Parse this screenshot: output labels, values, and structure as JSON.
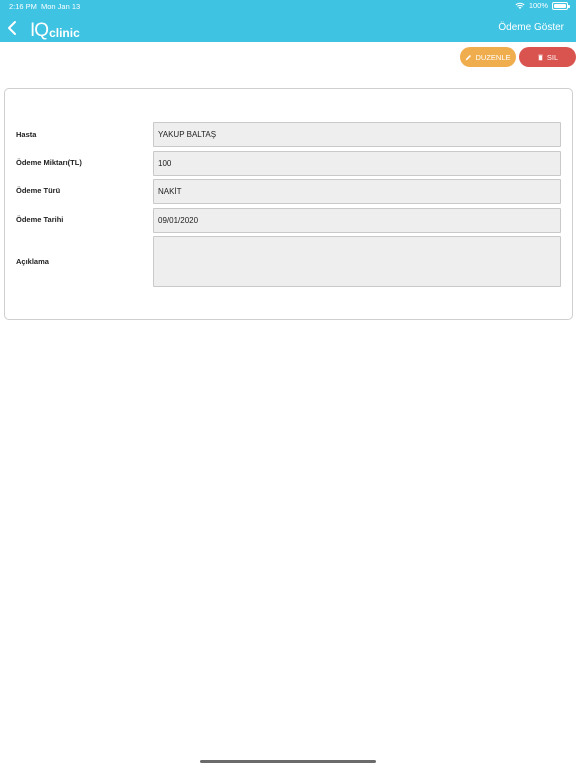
{
  "status_bar": {
    "time": "2:16 PM",
    "date": "Mon Jan 13",
    "battery": "100%"
  },
  "header": {
    "back_icon": "chevron-left-icon",
    "logo_mark": "IQ",
    "logo_text": "clinic",
    "title": "Ödeme Göster",
    "background_color": "#3fc3e2"
  },
  "actions": {
    "edit_label": "DUZENLE",
    "edit_icon": "pencil-icon",
    "edit_color": "#f0ad4e",
    "delete_label": "SIL",
    "delete_icon": "trash-icon",
    "delete_color": "#d9534f"
  },
  "form": {
    "patient_label": "Hasta",
    "patient_value": "YAKUP BALTAŞ",
    "amount_label": "Ödeme Miktarı(TL)",
    "amount_value": "100",
    "type_label": "Ödeme Türü",
    "type_value": "NAKİT",
    "date_label": "Ödeme Tarihi",
    "date_value": "09/01/2020",
    "note_label": "Açıklama",
    "note_value": ""
  }
}
